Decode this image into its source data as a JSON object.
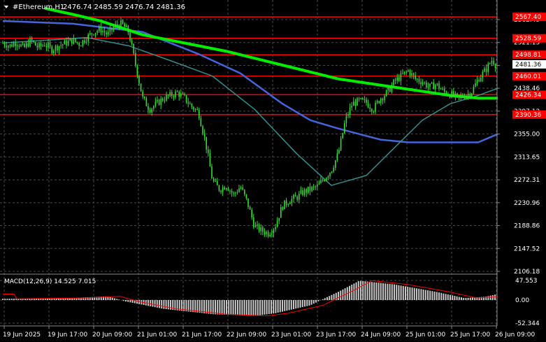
{
  "header": {
    "symbol": "#Ethereum,H1",
    "ohlc": "2476.74 2485.59 2476.74 2481.36"
  },
  "colors": {
    "background": "#000000",
    "grid": "#4a4a4a",
    "candle": "#33dd33",
    "ma_fast": "#00ee00",
    "ma_mid": "#2f8f8f",
    "ma_slow": "#4466dd",
    "level": "#ff0000",
    "text": "#ffffff",
    "macd_hist": "#c8c8c8",
    "macd_signal": "#ff0000"
  },
  "price_axis": {
    "ticks": [
      "2562.49",
      "2521.15",
      "2479.81",
      "2438.46",
      "2397.12",
      "2355.00",
      "2313.65",
      "2272.31",
      "2230.96",
      "2188.86",
      "2147.52",
      "2106.18"
    ],
    "current_price": "2481.36"
  },
  "levels": [
    {
      "price": 2567.4,
      "label": "2567.40"
    },
    {
      "price": 2528.59,
      "label": "2528.59"
    },
    {
      "price": 2498.81,
      "label": "2498.81"
    },
    {
      "price": 2460.01,
      "label": "2460.01"
    },
    {
      "price": 2426.34,
      "label": "2426.34"
    },
    {
      "price": 2390.36,
      "label": "2390.36"
    }
  ],
  "macd": {
    "label": "MACD(12,26,9) 14.525 7.015",
    "ticks": [
      "47.553",
      "0.00",
      "-52.344"
    ]
  },
  "time_axis": {
    "labels": [
      "19 Jun 2025",
      "19 Jun 17:00",
      "20 Jun 09:00",
      "21 Jun 01:00",
      "21 Jun 17:00",
      "22 Jun 09:00",
      "23 Jun 01:00",
      "23 Jun 17:00",
      "24 Jun 09:00",
      "25 Jun 01:00",
      "25 Jun 17:00",
      "26 Jun 09:00"
    ]
  },
  "chart_data": {
    "type": "candlestick",
    "series": [
      {
        "name": "close",
        "x": [
          0,
          10,
          20,
          30,
          40,
          50,
          60,
          70,
          80,
          90,
          100,
          110,
          120,
          130,
          140,
          150,
          160,
          170,
          180,
          190,
          200,
          210,
          220,
          230,
          240,
          250,
          260,
          270,
          280,
          290,
          300,
          310,
          320,
          330,
          340,
          350,
          360,
          370,
          380,
          390,
          400,
          410,
          420,
          430,
          440,
          450,
          460,
          470,
          480,
          490,
          500,
          510,
          520,
          530,
          540,
          550,
          560,
          570,
          580,
          590,
          600,
          610,
          620,
          630,
          640,
          650,
          660,
          670,
          680,
          690,
          700,
          705
        ],
        "values": [
          2520,
          2515,
          2522,
          2510,
          2525,
          2512,
          2518,
          2508,
          2515,
          2520,
          2525,
          2518,
          2530,
          2540,
          2545,
          2535,
          2550,
          2555,
          2540,
          2480,
          2420,
          2400,
          2410,
          2420,
          2425,
          2430,
          2420,
          2405,
          2395,
          2340,
          2270,
          2255,
          2262,
          2245,
          2260,
          2230,
          2188,
          2180,
          2175,
          2190,
          2225,
          2235,
          2240,
          2250,
          2255,
          2260,
          2275,
          2290,
          2320,
          2380,
          2410,
          2415,
          2412,
          2400,
          2420,
          2430,
          2450,
          2460,
          2470,
          2455,
          2450,
          2440,
          2445,
          2432,
          2428,
          2420,
          2425,
          2430,
          2455,
          2470,
          2490,
          2481
        ]
      },
      {
        "name": "ma_fast",
        "x": [
          60,
          100,
          140,
          200,
          260,
          320,
          400,
          480,
          560,
          640,
          680,
          708
        ],
        "values": [
          2583,
          2572,
          2560,
          2535,
          2520,
          2505,
          2480,
          2455,
          2440,
          2425,
          2420,
          2420
        ]
      },
      {
        "name": "ma_mid",
        "x": [
          0,
          60,
          120,
          180,
          240,
          300,
          360,
          420,
          470,
          520,
          560,
          600,
          640,
          680,
          708
        ],
        "values": [
          2520,
          2525,
          2530,
          2515,
          2488,
          2460,
          2400,
          2320,
          2262,
          2280,
          2330,
          2380,
          2410,
          2425,
          2438
        ]
      },
      {
        "name": "ma_slow",
        "x": [
          0,
          100,
          200,
          280,
          340,
          400,
          440,
          480,
          540,
          580,
          620,
          680,
          708
        ],
        "values": [
          2560,
          2555,
          2540,
          2500,
          2465,
          2410,
          2380,
          2365,
          2345,
          2340,
          2340,
          2340,
          2355
        ]
      }
    ]
  }
}
